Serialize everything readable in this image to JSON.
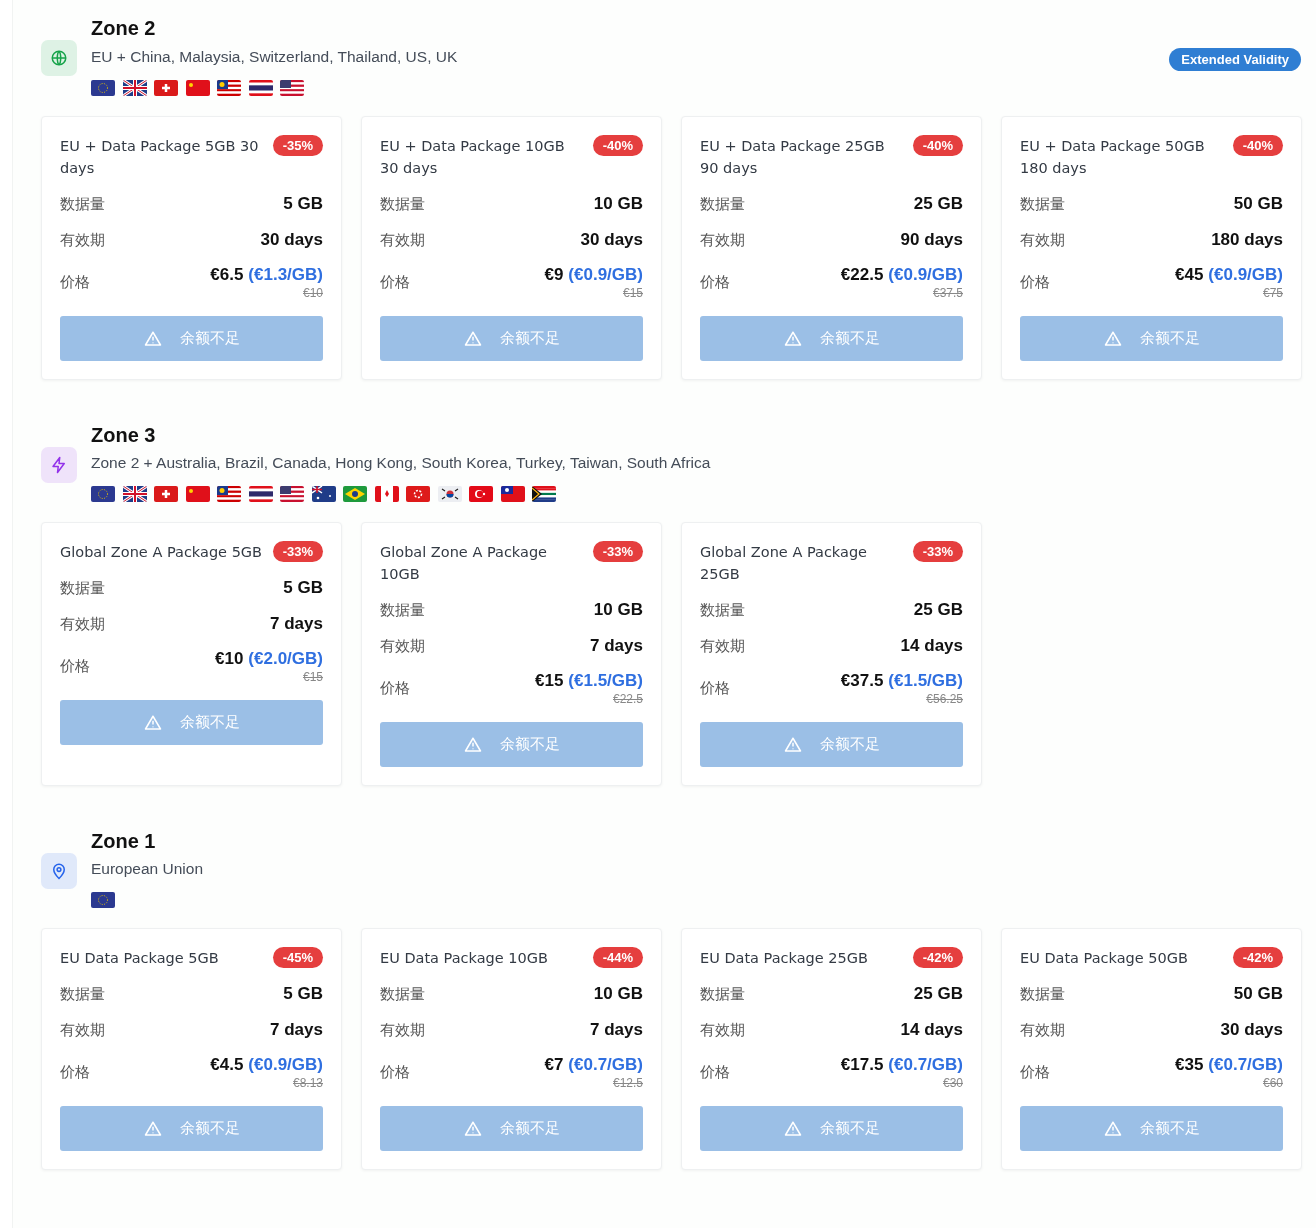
{
  "zones": [
    {
      "title": "Zone 2",
      "kind": "globe",
      "color": "#16a34a",
      "description": "EU + China, Malaysia, Switzerland, Thailand, US, UK",
      "badge": "Extended Validity",
      "flags": [
        {
          "kind": "eu"
        },
        {
          "kind": "gb"
        },
        {
          "kind": "ch"
        },
        {
          "kind": "cn"
        },
        {
          "kind": "my"
        },
        {
          "kind": "th"
        },
        {
          "kind": "us"
        }
      ],
      "packages": [
        {
          "title": "EU + Data Package 5GB 30 days",
          "discount": "-35%",
          "data_label": "数据量",
          "data": "5 GB",
          "validity_label": "有效期",
          "validity": "30 days",
          "price_label": "价格",
          "price": "€6.5",
          "per_gb": "(€1.3/GB)",
          "original_price": "€10",
          "button": {
            "label": "余额不足",
            "disabled": true
          }
        },
        {
          "title": "EU + Data Package 10GB 30 days",
          "discount": "-40%",
          "data_label": "数据量",
          "data": "10 GB",
          "validity_label": "有效期",
          "validity": "30 days",
          "price_label": "价格",
          "price": "€9",
          "per_gb": "(€0.9/GB)",
          "original_price": "€15",
          "button": {
            "label": "余额不足",
            "disabled": true
          }
        },
        {
          "title": "EU + Data Package 25GB 90 days",
          "discount": "-40%",
          "data_label": "数据量",
          "data": "25 GB",
          "validity_label": "有效期",
          "validity": "90 days",
          "price_label": "价格",
          "price": "€22.5",
          "per_gb": "(€0.9/GB)",
          "original_price": "€37.5",
          "button": {
            "label": "余额不足",
            "disabled": true
          }
        },
        {
          "title": "EU + Data Package 50GB 180 days",
          "discount": "-40%",
          "data_label": "数据量",
          "data": "50 GB",
          "validity_label": "有效期",
          "validity": "180 days",
          "price_label": "价格",
          "price": "€45",
          "per_gb": "(€0.9/GB)",
          "original_price": "€75",
          "button": {
            "label": "余额不足",
            "disabled": true
          }
        }
      ]
    },
    {
      "title": "Zone 3",
      "kind": "bolt",
      "color": "#9333ea",
      "description": "Zone 2 + Australia, Brazil, Canada, Hong Kong, South Korea, Turkey, Taiwan, South Africa",
      "flags": [
        {
          "kind": "eu"
        },
        {
          "kind": "gb"
        },
        {
          "kind": "ch"
        },
        {
          "kind": "cn"
        },
        {
          "kind": "my"
        },
        {
          "kind": "th"
        },
        {
          "kind": "us"
        },
        {
          "kind": "au"
        },
        {
          "kind": "br"
        },
        {
          "kind": "ca"
        },
        {
          "kind": "hk"
        },
        {
          "kind": "kr"
        },
        {
          "kind": "tr"
        },
        {
          "kind": "tw"
        },
        {
          "kind": "za"
        }
      ],
      "packages": [
        {
          "title": "Global Zone A Package 5GB",
          "discount": "-33%",
          "data_label": "数据量",
          "data": "5 GB",
          "validity_label": "有效期",
          "validity": "7 days",
          "price_label": "价格",
          "price": "€10",
          "per_gb": "(€2.0/GB)",
          "original_price": "€15",
          "button": {
            "label": "余额不足",
            "disabled": true
          }
        },
        {
          "title": "Global Zone A Package 10GB",
          "discount": "-33%",
          "data_label": "数据量",
          "data": "10 GB",
          "validity_label": "有效期",
          "validity": "7 days",
          "price_label": "价格",
          "price": "€15",
          "per_gb": "(€1.5/GB)",
          "original_price": "€22.5",
          "button": {
            "label": "余额不足",
            "disabled": true
          }
        },
        {
          "title": "Global Zone A Package 25GB",
          "discount": "-33%",
          "data_label": "数据量",
          "data": "25 GB",
          "validity_label": "有效期",
          "validity": "14 days",
          "price_label": "价格",
          "price": "€37.5",
          "per_gb": "(€1.5/GB)",
          "original_price": "€56.25",
          "button": {
            "label": "余额不足",
            "disabled": true
          }
        }
      ]
    },
    {
      "title": "Zone 1",
      "kind": "pin",
      "color": "#2563eb",
      "description": "European Union",
      "flags": [
        {
          "kind": "eu"
        }
      ],
      "packages": [
        {
          "title": "EU Data Package 5GB",
          "discount": "-45%",
          "data_label": "数据量",
          "data": "5 GB",
          "validity_label": "有效期",
          "validity": "7 days",
          "price_label": "价格",
          "price": "€4.5",
          "per_gb": "(€0.9/GB)",
          "original_price": "€8.13",
          "button": {
            "label": "余额不足",
            "disabled": true
          }
        },
        {
          "title": "EU Data Package 10GB",
          "discount": "-44%",
          "data_label": "数据量",
          "data": "10 GB",
          "validity_label": "有效期",
          "validity": "7 days",
          "price_label": "价格",
          "price": "€7",
          "per_gb": "(€0.7/GB)",
          "original_price": "€12.5",
          "button": {
            "label": "余额不足",
            "disabled": true
          }
        },
        {
          "title": "EU Data Package 25GB",
          "discount": "-42%",
          "data_label": "数据量",
          "data": "25 GB",
          "validity_label": "有效期",
          "validity": "14 days",
          "price_label": "价格",
          "price": "€17.5",
          "per_gb": "(€0.7/GB)",
          "original_price": "€30",
          "button": {
            "label": "余额不足",
            "disabled": true
          }
        },
        {
          "title": "EU Data Package 50GB",
          "discount": "-42%",
          "data_label": "数据量",
          "data": "50 GB",
          "validity_label": "有效期",
          "validity": "30 days",
          "price_label": "价格",
          "price": "€35",
          "per_gb": "(€0.7/GB)",
          "original_price": "€60",
          "button": {
            "label": "余额不足",
            "disabled": true
          }
        }
      ]
    }
  ]
}
